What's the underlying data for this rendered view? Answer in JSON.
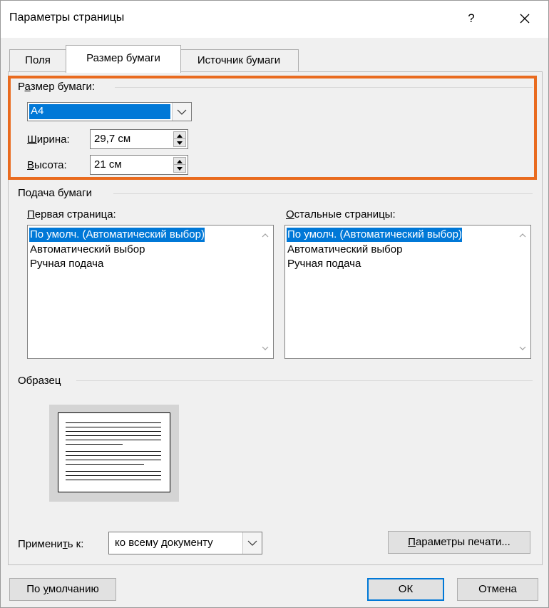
{
  "window": {
    "title": "Параметры страницы",
    "help_label": "?",
    "close_icon": "close-icon"
  },
  "tabs": [
    {
      "label": "Поля",
      "active": false
    },
    {
      "label": "Размер бумаги",
      "active": true
    },
    {
      "label": "Источник бумаги",
      "active": false
    }
  ],
  "paper_size": {
    "group_title_pre": "Р",
    "group_title_ul": "а",
    "group_title_post": "змер бумаги:",
    "selected": "A4",
    "width_label_ul": "Ш",
    "width_label_post": "ирина:",
    "width_value": "29,7 см",
    "height_label_ul": "В",
    "height_label_post": "ысота:",
    "height_value": "21 см"
  },
  "paper_source": {
    "group_title": "Подача бумаги",
    "first_page": {
      "label_ul": "П",
      "label_post": "ервая страница:",
      "items": [
        "По умолч. (Автоматический выбор)",
        "Автоматический выбор",
        "Ручная подача"
      ],
      "selected_index": 0
    },
    "other_pages": {
      "label_ul": "О",
      "label_post": "стальные страницы:",
      "items": [
        "По умолч. (Автоматический выбор)",
        "Автоматический выбор",
        "Ручная подача"
      ],
      "selected_index": 0
    }
  },
  "preview": {
    "group_title": "Образец"
  },
  "apply": {
    "label_pre": "Примени",
    "label_ul": "т",
    "label_post": "ь к:",
    "value": "ко всему документу"
  },
  "buttons": {
    "print_options_ul": "П",
    "print_options_post": "араметры печати...",
    "default_pre": "По ",
    "default_ul": "у",
    "default_post": "молчанию",
    "ok": "ОК",
    "cancel": "Отмена"
  },
  "colors": {
    "accent": "#0078d7",
    "highlight_border": "#e96b1f",
    "dialog_bg": "#f0f0f0"
  }
}
